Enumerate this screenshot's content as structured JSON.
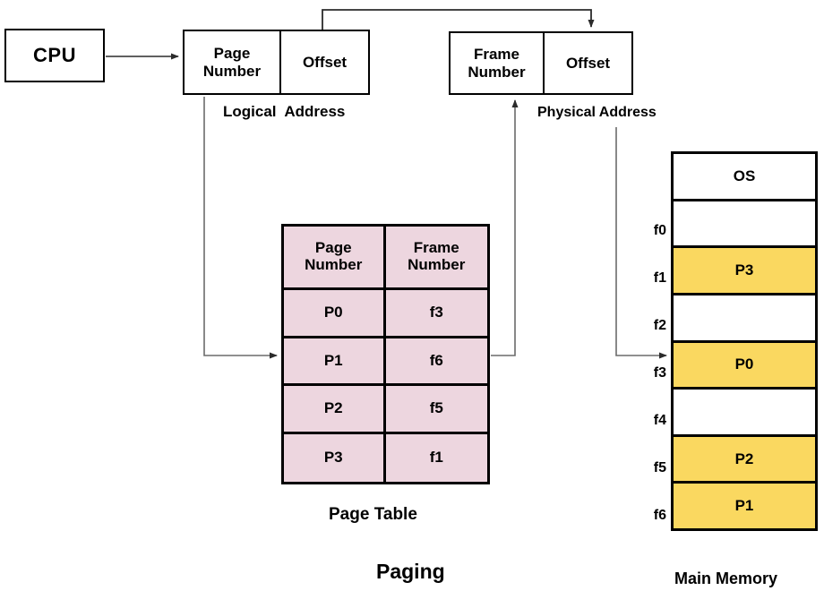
{
  "diagram": {
    "title": "Paging",
    "cpu": {
      "label": "CPU"
    },
    "logical_address": {
      "caption": "Logical  Address",
      "fields": [
        {
          "label": "Page\nNumber",
          "name": "page-number"
        },
        {
          "label": "Offset",
          "name": "offset"
        }
      ]
    },
    "physical_address": {
      "caption": "Physical Address",
      "fields": [
        {
          "label": "Frame\nNumber",
          "name": "frame-number"
        },
        {
          "label": "Offset",
          "name": "offset"
        }
      ]
    },
    "page_table": {
      "caption": "Page Table",
      "headers": [
        "Page\nNumber",
        "Frame\nNumber"
      ],
      "rows": [
        {
          "page": "P0",
          "frame": "f3"
        },
        {
          "page": "P1",
          "frame": "f6"
        },
        {
          "page": "P2",
          "frame": "f5"
        },
        {
          "page": "P3",
          "frame": "f1"
        }
      ]
    },
    "main_memory": {
      "caption": "Main Memory",
      "rows": [
        {
          "frame_label": "",
          "content": "OS",
          "filled": false
        },
        {
          "frame_label": "f0",
          "content": "",
          "filled": false
        },
        {
          "frame_label": "f1",
          "content": "P3",
          "filled": true
        },
        {
          "frame_label": "f2",
          "content": "",
          "filled": false
        },
        {
          "frame_label": "f3",
          "content": "P0",
          "filled": true
        },
        {
          "frame_label": "f4",
          "content": "",
          "filled": false
        },
        {
          "frame_label": "f5",
          "content": "P2",
          "filled": true
        },
        {
          "frame_label": "f6",
          "content": "P1",
          "filled": true
        }
      ]
    },
    "colors": {
      "page_table_fill": "#EDD6DF",
      "memory_used_fill": "#FAD860",
      "stroke": "#000000",
      "background": "#FFFFFF"
    }
  }
}
